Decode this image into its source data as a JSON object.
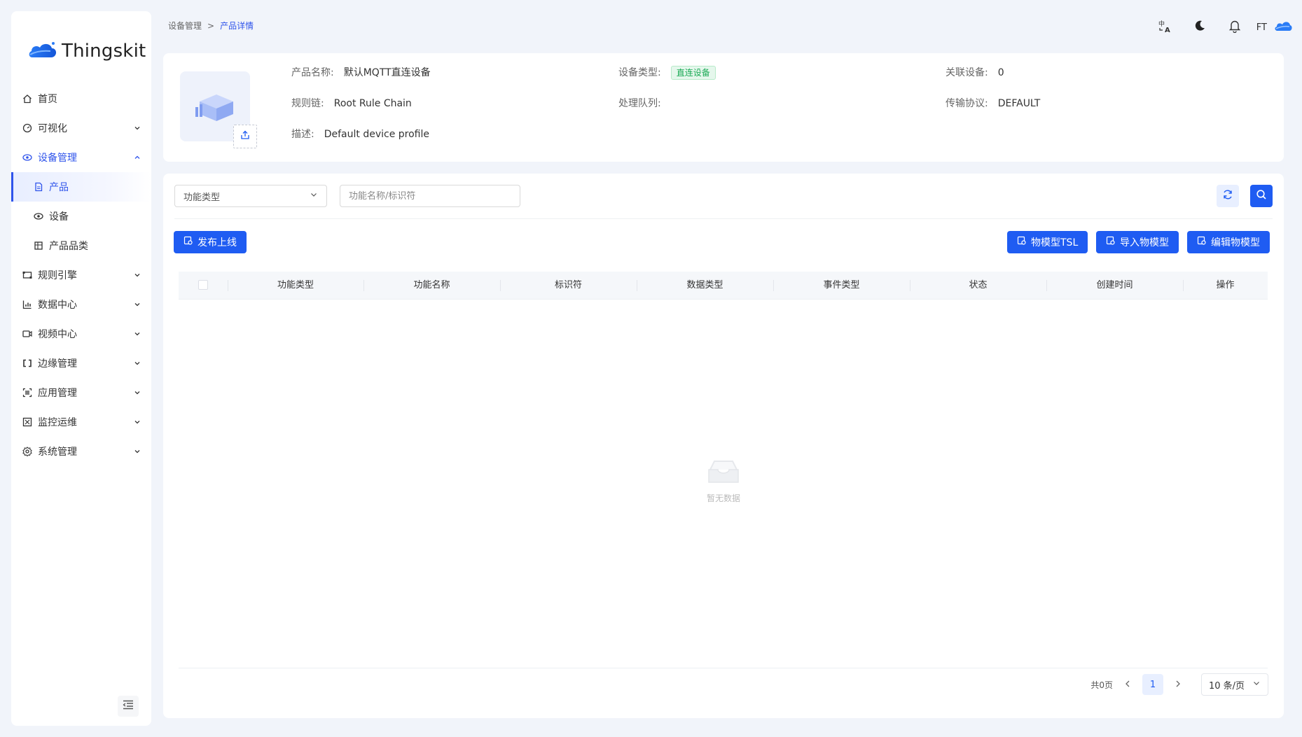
{
  "app": {
    "name": "Thingskit"
  },
  "breadcrumb": {
    "parent": "设备管理",
    "separator": ">",
    "current": "产品详情"
  },
  "header": {
    "user_initials": "FT"
  },
  "sidebar": {
    "items": [
      {
        "label": "首页",
        "icon": "home-icon",
        "has_children": false
      },
      {
        "label": "可视化",
        "icon": "dashboard-icon",
        "has_children": true
      },
      {
        "label": "设备管理",
        "icon": "device-manage-icon",
        "has_children": true,
        "expanded": true,
        "children": [
          {
            "label": "产品",
            "icon": "file-icon",
            "active": true
          },
          {
            "label": "设备",
            "icon": "device-icon"
          },
          {
            "label": "产品品类",
            "icon": "category-icon"
          }
        ]
      },
      {
        "label": "规则引擎",
        "icon": "rule-engine-icon",
        "has_children": true
      },
      {
        "label": "数据中心",
        "icon": "bar-chart-icon",
        "has_children": true
      },
      {
        "label": "视频中心",
        "icon": "video-icon",
        "has_children": true
      },
      {
        "label": "边缘管理",
        "icon": "edge-icon",
        "has_children": true
      },
      {
        "label": "应用管理",
        "icon": "app-icon",
        "has_children": true
      },
      {
        "label": "监控运维",
        "icon": "monitor-icon",
        "has_children": true
      },
      {
        "label": "系统管理",
        "icon": "settings-icon",
        "has_children": true
      }
    ]
  },
  "product": {
    "name_label": "产品名称:",
    "name": "默认MQTT直连设备",
    "type_label": "设备类型:",
    "type": "直连设备",
    "linked_label": "关联设备:",
    "linked": "0",
    "rule_chain_label": "规则链:",
    "rule_chain": "Root Rule Chain",
    "queue_label": "处理队列:",
    "queue": "",
    "protocol_label": "传输协议:",
    "protocol": "DEFAULT",
    "desc_label": "描述:",
    "desc": "Default device profile"
  },
  "filters": {
    "function_type_placeholder": "功能类型",
    "search_placeholder": "功能名称/标识符"
  },
  "actions": {
    "publish": "发布上线",
    "tsl": "物模型TSL",
    "import": "导入物模型",
    "edit": "编辑物模型"
  },
  "table": {
    "columns": [
      "功能类型",
      "功能名称",
      "标识符",
      "数据类型",
      "事件类型",
      "状态",
      "创建时间",
      "操作"
    ],
    "empty_text": "暂无数据"
  },
  "pagination": {
    "total_text": "共0页",
    "current_page": "1",
    "page_size": "10 条/页"
  },
  "colors": {
    "primary": "#1f5cf2",
    "active_nav": "#2f54eb",
    "tag_green": "#1aaa55"
  }
}
